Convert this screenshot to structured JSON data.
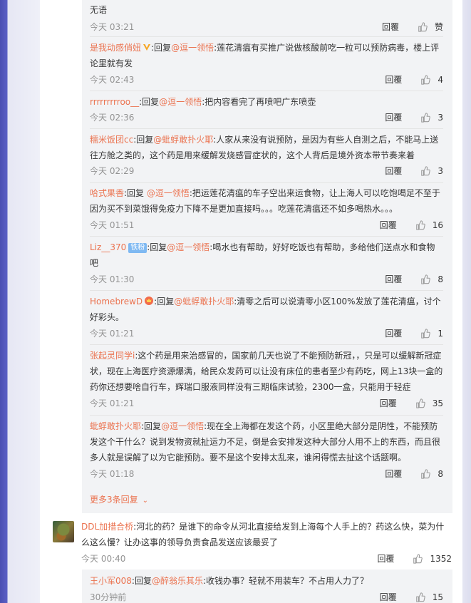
{
  "reply_label": "回覆",
  "colors": {
    "accent": "#eb7350",
    "background": "#e9eaf5",
    "subbg": "#f2f3f5"
  },
  "comments": [
    {
      "body_tail": "无语",
      "time": "今天 03:21",
      "likes": "赞"
    },
    {
      "user": "是我动感俏妞",
      "prefix": ":回复",
      "mention": "@逗一领悟",
      "text": ":莲花清瘟有买推广说做核酸前吃一粒可以预防病毒，楼上评论里就有发",
      "time": "今天 02:43",
      "likes": "4"
    },
    {
      "user": "rrrrrrrrroo__",
      "prefix": ":回复",
      "mention": "@逗一领悟",
      "text": ":把内容看完了再喷吧广东喷壶",
      "time": "今天 02:36",
      "likes": "3"
    },
    {
      "user": "糯米饭团cc",
      "prefix": ":回复",
      "mention": "@蚍蜉敢扑火耶",
      "text": ":人家从来没有说预防，是因为有些人自测之后，不能马上送往方舱之类的，这个药是用来缓解发烧感冒症状的，这个人背后是境外资本带节奏来着",
      "time": "今天 02:29",
      "likes": "3"
    },
    {
      "user": "哈式果香",
      "prefix": ":回复 ",
      "mention": "@逗一领悟",
      "text": ":把运莲花清瘟的车子空出来运食物，让上海人可以吃饱喝足不至于因为买不到菜饿得免疫力下降不是更加直接吗。。。吃莲花清瘟还不如多喝热水。。。",
      "time": "今天 01:51",
      "likes": "16"
    },
    {
      "user": "Liz__370",
      "badge": "铁粉",
      "prefix": ":回复",
      "mention": "@逗一领悟",
      "text": ":喝水也有帮助，好好吃饭也有帮助，多给他们送点水和食物吧",
      "time": "今天 01:30",
      "likes": "8"
    },
    {
      "user": "HomebrewD",
      "prefix": ":回复",
      "mention": "@蚍蜉敢扑火耶",
      "text": ":清零之后可以说清零小区100%发放了莲花清瘟，讨个好彩头。",
      "time": "今天 01:21",
      "likes": "1"
    },
    {
      "user": "张起灵同学i",
      "prefix": ":",
      "mention": "",
      "text": "这个药是用来治感冒的，国家前几天也说了不能预防新冠，，只是可以缓解新冠症状，现在上海医疗资源爆满，给民众发药可以让没有床位的患者至少有药吃，网上13块一盒的药你还想要啥自行车，辉瑞口服液同样没有三期临床试验，2300一盒，只能用于轻症",
      "time": "今天 01:21",
      "likes": "35"
    },
    {
      "user": "蚍蜉敢扑火耶",
      "prefix": ":回复",
      "mention": "@逗一领悟",
      "text": ":现在全上海都在发这个药，小区里绝大部分是阴性，不能预防发这个干什么？说到发物资就扯运力不足，倒是会安排发这种大部分人用不上的东西，而且很多人就是误解了以为它能预防。要不是这个安排太乱来，谁闲得慌去扯这个话题啊。",
      "time": "今天 01:18",
      "likes": "8"
    }
  ],
  "more_replies": "更多3条回复",
  "top_comment": {
    "user": "DDL加措合桥",
    "text": ":河北的药？是谁下的命令从河北直接给发到上海每个人手上的？药这么快，菜为什么这么慢？让办这事的领导负责食品发送应该最妥了",
    "time": "今天 00:40",
    "likes": "1352"
  },
  "last_sub": {
    "user": "王小军008",
    "prefix": ":回复",
    "mention": "@醉翁乐其乐",
    "text": ":收钱办事？轻就不用装车？不占用人力了？",
    "time": "30分钟前",
    "likes": "15"
  }
}
